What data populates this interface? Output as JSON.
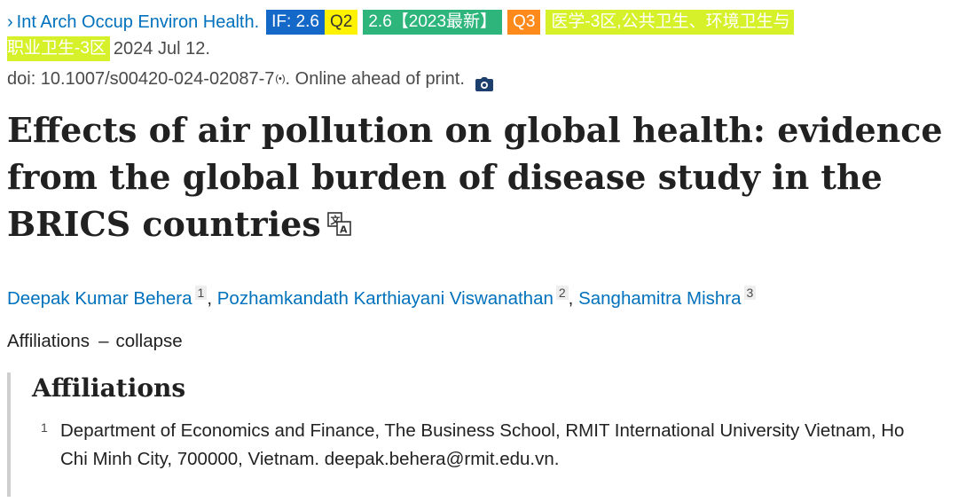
{
  "citation": {
    "journal_chevron": "›",
    "journal": "Int Arch Occup Environ Health.",
    "badges": {
      "impact_factor": "IF: 2.6",
      "jcr_quartile": "Q2",
      "cas_year": "2.6【2023最新】",
      "cas_quartile": "Q3",
      "category_part1": "医学-3区,公共卫生、环境卫生与",
      "category_part2": "职业卫生-3区"
    },
    "date": "2024 Jul 12.",
    "doi_text": "doi: 10.1007/s00420-024-02087-7",
    "doi_marker": "(•)",
    "status": ". Online ahead of print."
  },
  "article": {
    "title": "Effects of air pollution on global health: evidence from the global burden of disease study in the BRICS countries"
  },
  "authors": [
    {
      "name": "Deepak Kumar Behera",
      "aff": "1"
    },
    {
      "name": "Pozhamkandath Karthiayani Viswanathan",
      "aff": "2"
    },
    {
      "name": "Sanghamitra Mishra",
      "aff": "3"
    }
  ],
  "affiliations_toggle": {
    "label": "Affiliations",
    "dash": "–",
    "action": "collapse"
  },
  "affiliations": {
    "heading": "Affiliations",
    "items": [
      {
        "num": "1",
        "text": "Department of Economics and Finance, The Business School, RMIT International University Vietnam, Ho Chi Minh City, 700000, Vietnam. deepak.behera@rmit.edu.vn."
      }
    ]
  },
  "icons": {
    "camera": "camera-icon",
    "translate": "translate-icon"
  },
  "colors": {
    "link": "#0071bc",
    "if_badge": "#1468c8",
    "q2_badge": "#fff200",
    "cas_badge": "#2db57c",
    "q3_badge": "#ff8a1c",
    "category_badge": "#d6f02a"
  }
}
